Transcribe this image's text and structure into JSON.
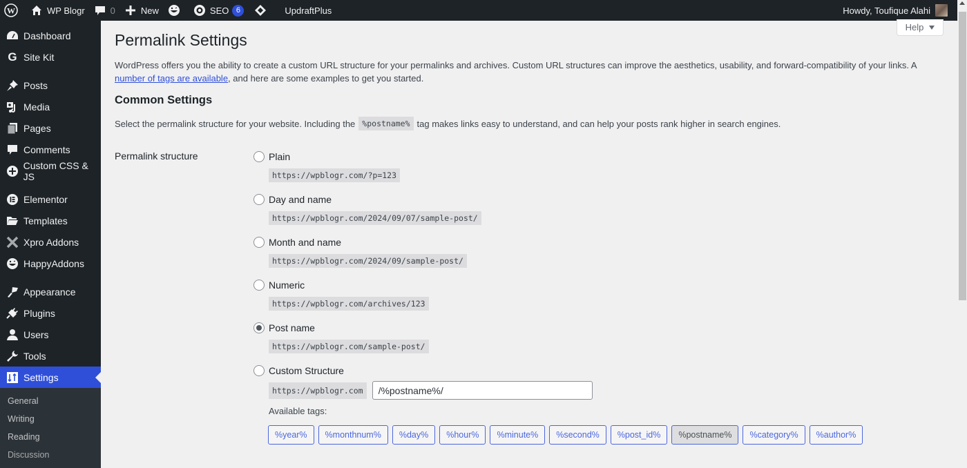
{
  "adminbar": {
    "site_name": "WP Blogr",
    "comments_count": "0",
    "new_label": "New",
    "seo_label": "SEO",
    "seo_badge": "6",
    "updraft_label": "UpdraftPlus",
    "howdy": "Howdy, Toufique Alahi"
  },
  "sidebar": {
    "items": [
      {
        "label": "Dashboard",
        "icon": "dashboard-icon"
      },
      {
        "label": "Site Kit",
        "icon": "google-icon"
      },
      {
        "label": "Posts",
        "icon": "pin-icon"
      },
      {
        "label": "Media",
        "icon": "media-icon"
      },
      {
        "label": "Pages",
        "icon": "pages-icon"
      },
      {
        "label": "Comments",
        "icon": "comment-icon"
      },
      {
        "label": "Custom CSS & JS",
        "icon": "plus-circle-icon"
      },
      {
        "label": "Elementor",
        "icon": "elementor-icon"
      },
      {
        "label": "Templates",
        "icon": "folder-icon"
      },
      {
        "label": "Xpro Addons",
        "icon": "x-icon"
      },
      {
        "label": "HappyAddons",
        "icon": "happy-face-icon"
      },
      {
        "label": "Appearance",
        "icon": "brush-icon"
      },
      {
        "label": "Plugins",
        "icon": "plug-icon"
      },
      {
        "label": "Users",
        "icon": "user-icon"
      },
      {
        "label": "Tools",
        "icon": "wrench-icon"
      },
      {
        "label": "Settings",
        "icon": "settings-icon"
      }
    ],
    "submenu": [
      "General",
      "Writing",
      "Reading",
      "Discussion"
    ]
  },
  "help_label": "Help",
  "page": {
    "title": "Permalink Settings",
    "intro_text": "WordPress offers you the ability to create a custom URL structure for your permalinks and archives. Custom URL structures can improve the aesthetics, usability, and forward-compatibility of your links. A ",
    "intro_link": "number of tags are available",
    "intro_tail": ", and here are some examples to get you started.",
    "section_title": "Common Settings",
    "select_text_before": "Select the permalink structure for your website. Including the",
    "select_code": "%postname%",
    "select_text_after": "tag makes links easy to understand, and can help your posts rank higher in search engines.",
    "row_label": "Permalink structure",
    "options": [
      {
        "label": "Plain",
        "example": "https://wpblogr.com/?p=123",
        "checked": false
      },
      {
        "label": "Day and name",
        "example": "https://wpblogr.com/2024/09/07/sample-post/",
        "checked": false
      },
      {
        "label": "Month and name",
        "example": "https://wpblogr.com/2024/09/sample-post/",
        "checked": false
      },
      {
        "label": "Numeric",
        "example": "https://wpblogr.com/archives/123",
        "checked": false
      },
      {
        "label": "Post name",
        "example": "https://wpblogr.com/sample-post/",
        "checked": true
      },
      {
        "label": "Custom Structure",
        "prefix": "https://wpblogr.com",
        "value": "/%postname%/",
        "checked": false
      }
    ],
    "available_tags_label": "Available tags:",
    "tags": [
      "%year%",
      "%monthnum%",
      "%day%",
      "%hour%",
      "%minute%",
      "%second%",
      "%post_id%",
      "%postname%",
      "%category%",
      "%author%"
    ],
    "active_tag": "%postname%"
  }
}
